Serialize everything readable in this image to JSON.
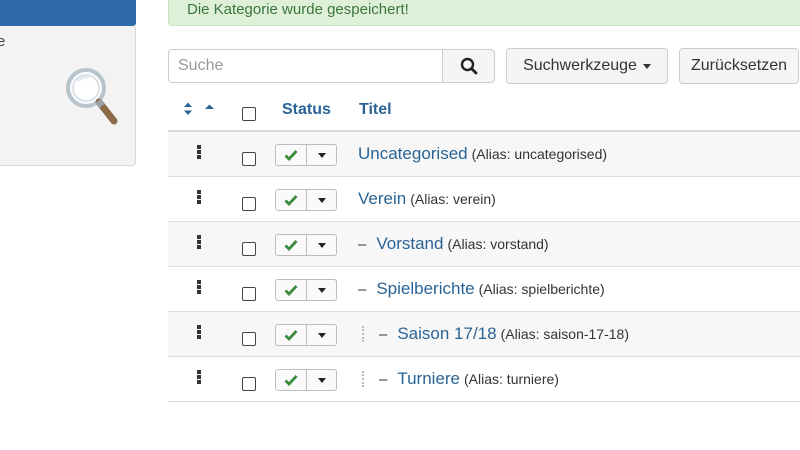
{
  "sidebar": {
    "partial_text": "e"
  },
  "alert": {
    "message": "Die Kategorie wurde gespeichert!"
  },
  "toolbar": {
    "search_placeholder": "Suche",
    "search_tools_label": "Suchwerkzeuge",
    "reset_label": "Zurücksetzen"
  },
  "table": {
    "headers": {
      "status": "Status",
      "title": "Titel"
    },
    "rows": [
      {
        "title": "Uncategorised",
        "alias": "(Alias: uncategorised)",
        "level": 1,
        "published": true
      },
      {
        "title": "Verein",
        "alias": "(Alias: verein)",
        "level": 1,
        "published": true
      },
      {
        "title": "Vorstand",
        "alias": "(Alias: vorstand)",
        "level": 2,
        "published": true
      },
      {
        "title": "Spielberichte",
        "alias": "(Alias: spielberichte)",
        "level": 2,
        "published": true
      },
      {
        "title": "Saison 17/18",
        "alias": "(Alias: saison-17-18)",
        "level": 3,
        "published": true
      },
      {
        "title": "Turniere",
        "alias": "(Alias: turniere)",
        "level": 3,
        "published": true
      }
    ]
  },
  "colors": {
    "link": "#2a6496",
    "success_bg": "#dff0d8",
    "success_text": "#3c763d",
    "sidebar_header": "#2f6aa8",
    "check_green": "#3c8a3c"
  },
  "tree_markers": {
    "child_dash": "–"
  }
}
